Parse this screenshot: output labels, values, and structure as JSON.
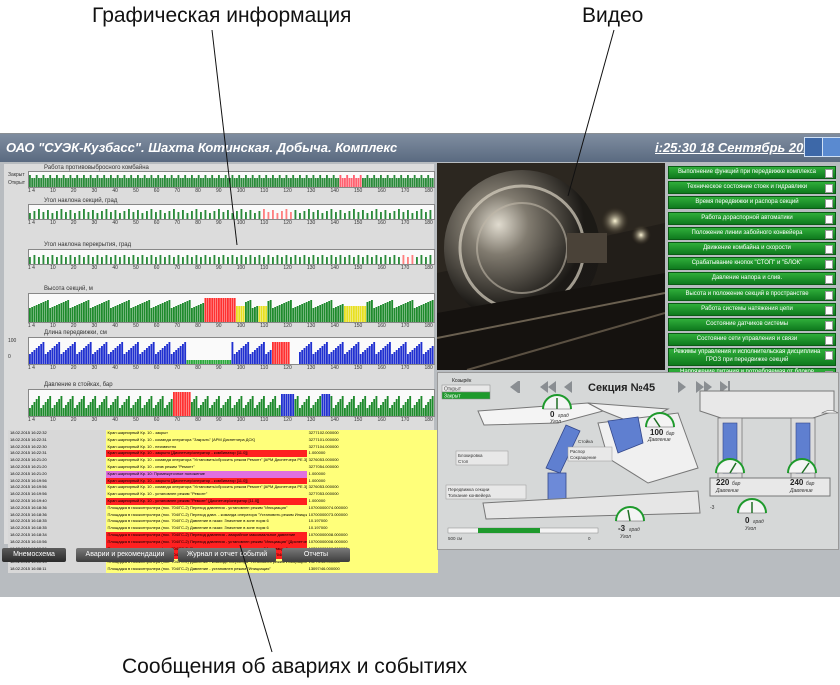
{
  "callouts": {
    "graphics": "Графическая информация",
    "video": "Видео",
    "messages": "Сообщения об авариях и событиях"
  },
  "header": {
    "title": "ОАО \"СУЭК-Кузбасс\".  Шахта Котинская.  Добыча.  Комплекс",
    "clock": "i:25:30 18 Сентябрь 2014 г."
  },
  "charts": {
    "work_label": "Работа противовыбросного комбайна",
    "axis_closed": "Закрыт",
    "axis_open": "Открыт",
    "roll_label": "Угол наклона секций, град",
    "pitch_label": "Угол наклона перекрытия, град",
    "height_label": "Высота секций, м",
    "advance_label": "Длина передвижки, см",
    "pressure_label": "Давление в стойках, бар",
    "y_100": "100",
    "y_0": "0",
    "section_ticks": [
      "1 4",
      "10",
      "20",
      "30",
      "40",
      "50",
      "60",
      "70",
      "80",
      "90",
      "100",
      "110",
      "120",
      "130",
      "140",
      "150",
      "160",
      "170",
      "180"
    ]
  },
  "events": [
    {
      "date": "18.02.2015 16:22:32",
      "msg": "Кран шарнирный Кр. 10 - закрыт",
      "code": "3277102.000000",
      "color": "#ffff7a"
    },
    {
      "date": "18.02.2015 16:22:31",
      "msg": "Кран шарнирный Кр. 10 - команда оператора \"Закрыть\" [APM Диспетчера ДСК]",
      "code": "3277101.000000",
      "color": "#ffff7a"
    },
    {
      "date": "18.02.2015 16:22:30",
      "msg": "Кран шарнирный Кр. 10 - неизвестно",
      "code": "3277104.000000",
      "color": "#ffff7a"
    },
    {
      "date": "18.02.2015 16:22:31",
      "msg": "Кран шарнирный Кр. 10 - закрыто [Диспетчер/оператор - комбинатор [11.0]]",
      "code": "1.000000",
      "color": "#ff2020"
    },
    {
      "date": "18.02.2015 16:21:20",
      "msg": "Кран шарнирный Кр. 10 - команда оператора \"Установить/сбросить режим Ремонт\" [APM Диспетчера РЕ.3]",
      "code": "3276053.000000",
      "color": "#ffff7a"
    },
    {
      "date": "18.02.2015 16:21:20",
      "msg": "Кран шарнирный Кр. 10 - сняв режим \"Ремонт\"",
      "code": "3277054.000000",
      "color": "#ffff7a"
    },
    {
      "date": "18.02.2015 16:21:20",
      "msg": "Кран шарнирный Кр. 10: Промежуточное положение",
      "code": "1.000000",
      "color": "#e070e0"
    },
    {
      "date": "18.02.2015 16:19:56",
      "msg": "Кран шарнирный Кр. 10 - закрыто [Диспетчер/оператор - комбинатор [11.0]]",
      "code": "1.000000",
      "color": "#ff2020"
    },
    {
      "date": "18.02.2015 16:19:56",
      "msg": "Кран шарнирный Кр. 10 - команда оператора \"Установить/сбросить режим Ремонт\" [APM Диспетчера РЕ.3]",
      "code": "3276053.000000",
      "color": "#ffff7a"
    },
    {
      "date": "18.02.2015 16:19:56",
      "msg": "Кран шарнирный Кр. 10 - установлен режим \"Ремонт\"",
      "code": "3277053.000000",
      "color": "#ffff7a"
    },
    {
      "date": "18.02.2015 16:19:40",
      "msg": "Кран шарнирный Кр. 10 - установлен режим \"Ремонт\" [Диспетчер/оператор [11.0]]",
      "code": "1.000000",
      "color": "#ff2020"
    },
    {
      "date": "18.02.2015 16:18:36",
      "msg": "Площадка в газоконтролера (пос. 704/ГС-2) Переход давления - установлен режим \"Инициация\"",
      "code": "10700000074.000000",
      "color": "#ffff7a"
    },
    {
      "date": "18.02.2015 16:18:36",
      "msg": "Площадка в газоконтролера (пос. 704/ГС-2) Переход давл. - команда оператора \"Установить режим Инициация\" [APM Диспетчера РЕ.3]",
      "code": "10700000073.000000",
      "color": "#ffff7a"
    },
    {
      "date": "18.02.2015 16:18:35",
      "msg": "Площадка в газоконтролера (пос. 704/ГС-2) Давление в газах: Значение в зоне норм 6",
      "code": "10.197000",
      "color": "#ffff7a"
    },
    {
      "date": "18.02.2015 16:18:35",
      "msg": "Площадка в газоконтролера (пос. 704/ГС-2) Давление в газах: Значение в зоне норм 6",
      "code": "10.197000",
      "color": "#ffff7a"
    },
    {
      "date": "18.02.2015 16:18:34",
      "msg": "Площадка в газоконтролера (пос. 704/ГС-2) Переход давления - аварийное максимальное давление",
      "code": "10700000008.000000",
      "color": "#ff2020"
    },
    {
      "date": "18.02.2015 16:10:56",
      "msg": "Площадка в газоконтролера (пос. 704/ГС-2) Переход давления - установлен режим \"Инициация\" [Диспетчер/оператор [11.0]]",
      "code": "10700000008.000000",
      "color": "#ff2020"
    },
    {
      "date": "18.02.2015 16:10:56",
      "msg": "Площадка в газоконтролера (пос. 704/ГС-2) Переход давления - установлен режим \"Инициация\"",
      "code": "10700000008.000000",
      "color": "#ff2020"
    },
    {
      "date": "18.02.2015 16:10:53",
      "msg": "Площадка в газоконтролера (пос. 704/ГС-2) Давление \"Площадка в газоконтролера (пос. 704/ГС-2) Давление в газах - аварийное макс. давление (11)\"",
      "code": "1.000000",
      "color": "#ff2020"
    },
    {
      "date": "18.02.2015 16:10:44",
      "msg": "Площадка в газоконтролера (пос. 704/ГС-2) Давление - команда оператора \"Установить режим Инициация\" [APM Диспетчера РЕ.3]",
      "code": "13273/46.000000",
      "color": "#ffff7a"
    },
    {
      "date": "18.02.2015 16:08:11",
      "msg": "Площадка в газоконтролера (пос. 704/ГС-2) Давление - установлен режим \"Инициация\"",
      "code": "13097/46.000000",
      "color": "#ffff7a"
    }
  ],
  "menu": [
    {
      "label": "Выполнение функций при передвижке комплекса",
      "tall": false
    },
    {
      "label": "Техническое состояние стоек и гидравлики",
      "tall": false
    },
    {
      "label": "Время передвижки и распора секций",
      "tall": false
    },
    {
      "label": "Работа дораспорной автоматики",
      "tall": false
    },
    {
      "label": "Положение линии забойного конвейера",
      "tall": false
    },
    {
      "label": "Движение комбайна и скорости",
      "tall": false
    },
    {
      "label": "Срабатывание кнопок \"СТОП\" и \"БЛОК\"",
      "tall": false
    },
    {
      "label": "Давление напора и слив.",
      "tall": false
    },
    {
      "label": "Высота и положение секций в пространстве",
      "tall": false
    },
    {
      "label": "Работа системы натяжения цепи",
      "tall": false
    },
    {
      "label": "Состояние датчиков системы",
      "tall": false
    },
    {
      "label": "Состояние сети управления и связи",
      "tall": false
    },
    {
      "label": "Режимы управления и исполнительская дисциплина ГРОЗ при передвижке секций",
      "tall": true
    },
    {
      "label": "Напряжение питания и потребляемая от блоков мощность",
      "tall": true
    }
  ],
  "section": {
    "title": "Секция №45",
    "canopy_label": "Козырёк",
    "canopy_open": "Открыт",
    "canopy_closed": "Закрыт",
    "blocking_label": "Блокировка",
    "stop_label": "Стоп",
    "stand_label": "Стойка",
    "spacer_label": "Распор",
    "contraction_label": "Сокращение",
    "advance_label": "Передвижка секции",
    "conveyor_label": "Толкание конвейера",
    "scale_left": "500 см",
    "scale_right": "0",
    "gauge_top": {
      "value": "0",
      "unit": "град",
      "caption": "Угол"
    },
    "gauge_pressure": {
      "value": "100",
      "unit": "бар",
      "caption": "Давление"
    },
    "gauge_bottom_left": {
      "value": "-3",
      "unit": "град",
      "caption": "Угол"
    },
    "gauge_bottom_mid": {
      "value": "-3",
      "unit": "град",
      "caption": "Угол"
    },
    "gauge_left_leg": {
      "value": "220",
      "unit": "бар",
      "caption": "Давление"
    },
    "gauge_right_leg": {
      "value": "240",
      "unit": "бар",
      "caption": "Давление"
    },
    "gauge_front": {
      "value": "0",
      "unit": "град",
      "caption": "Угол"
    }
  },
  "tabs": [
    "Мнемосхема",
    "Аварии и рекомендации",
    "Журнал и отчет событий",
    "Отчеты"
  ],
  "colors": {
    "accent_green": "#1e9a2c",
    "alarm_red": "#ff2020",
    "event_yellow": "#ffff7a",
    "bar_blue": "#2030d0"
  }
}
